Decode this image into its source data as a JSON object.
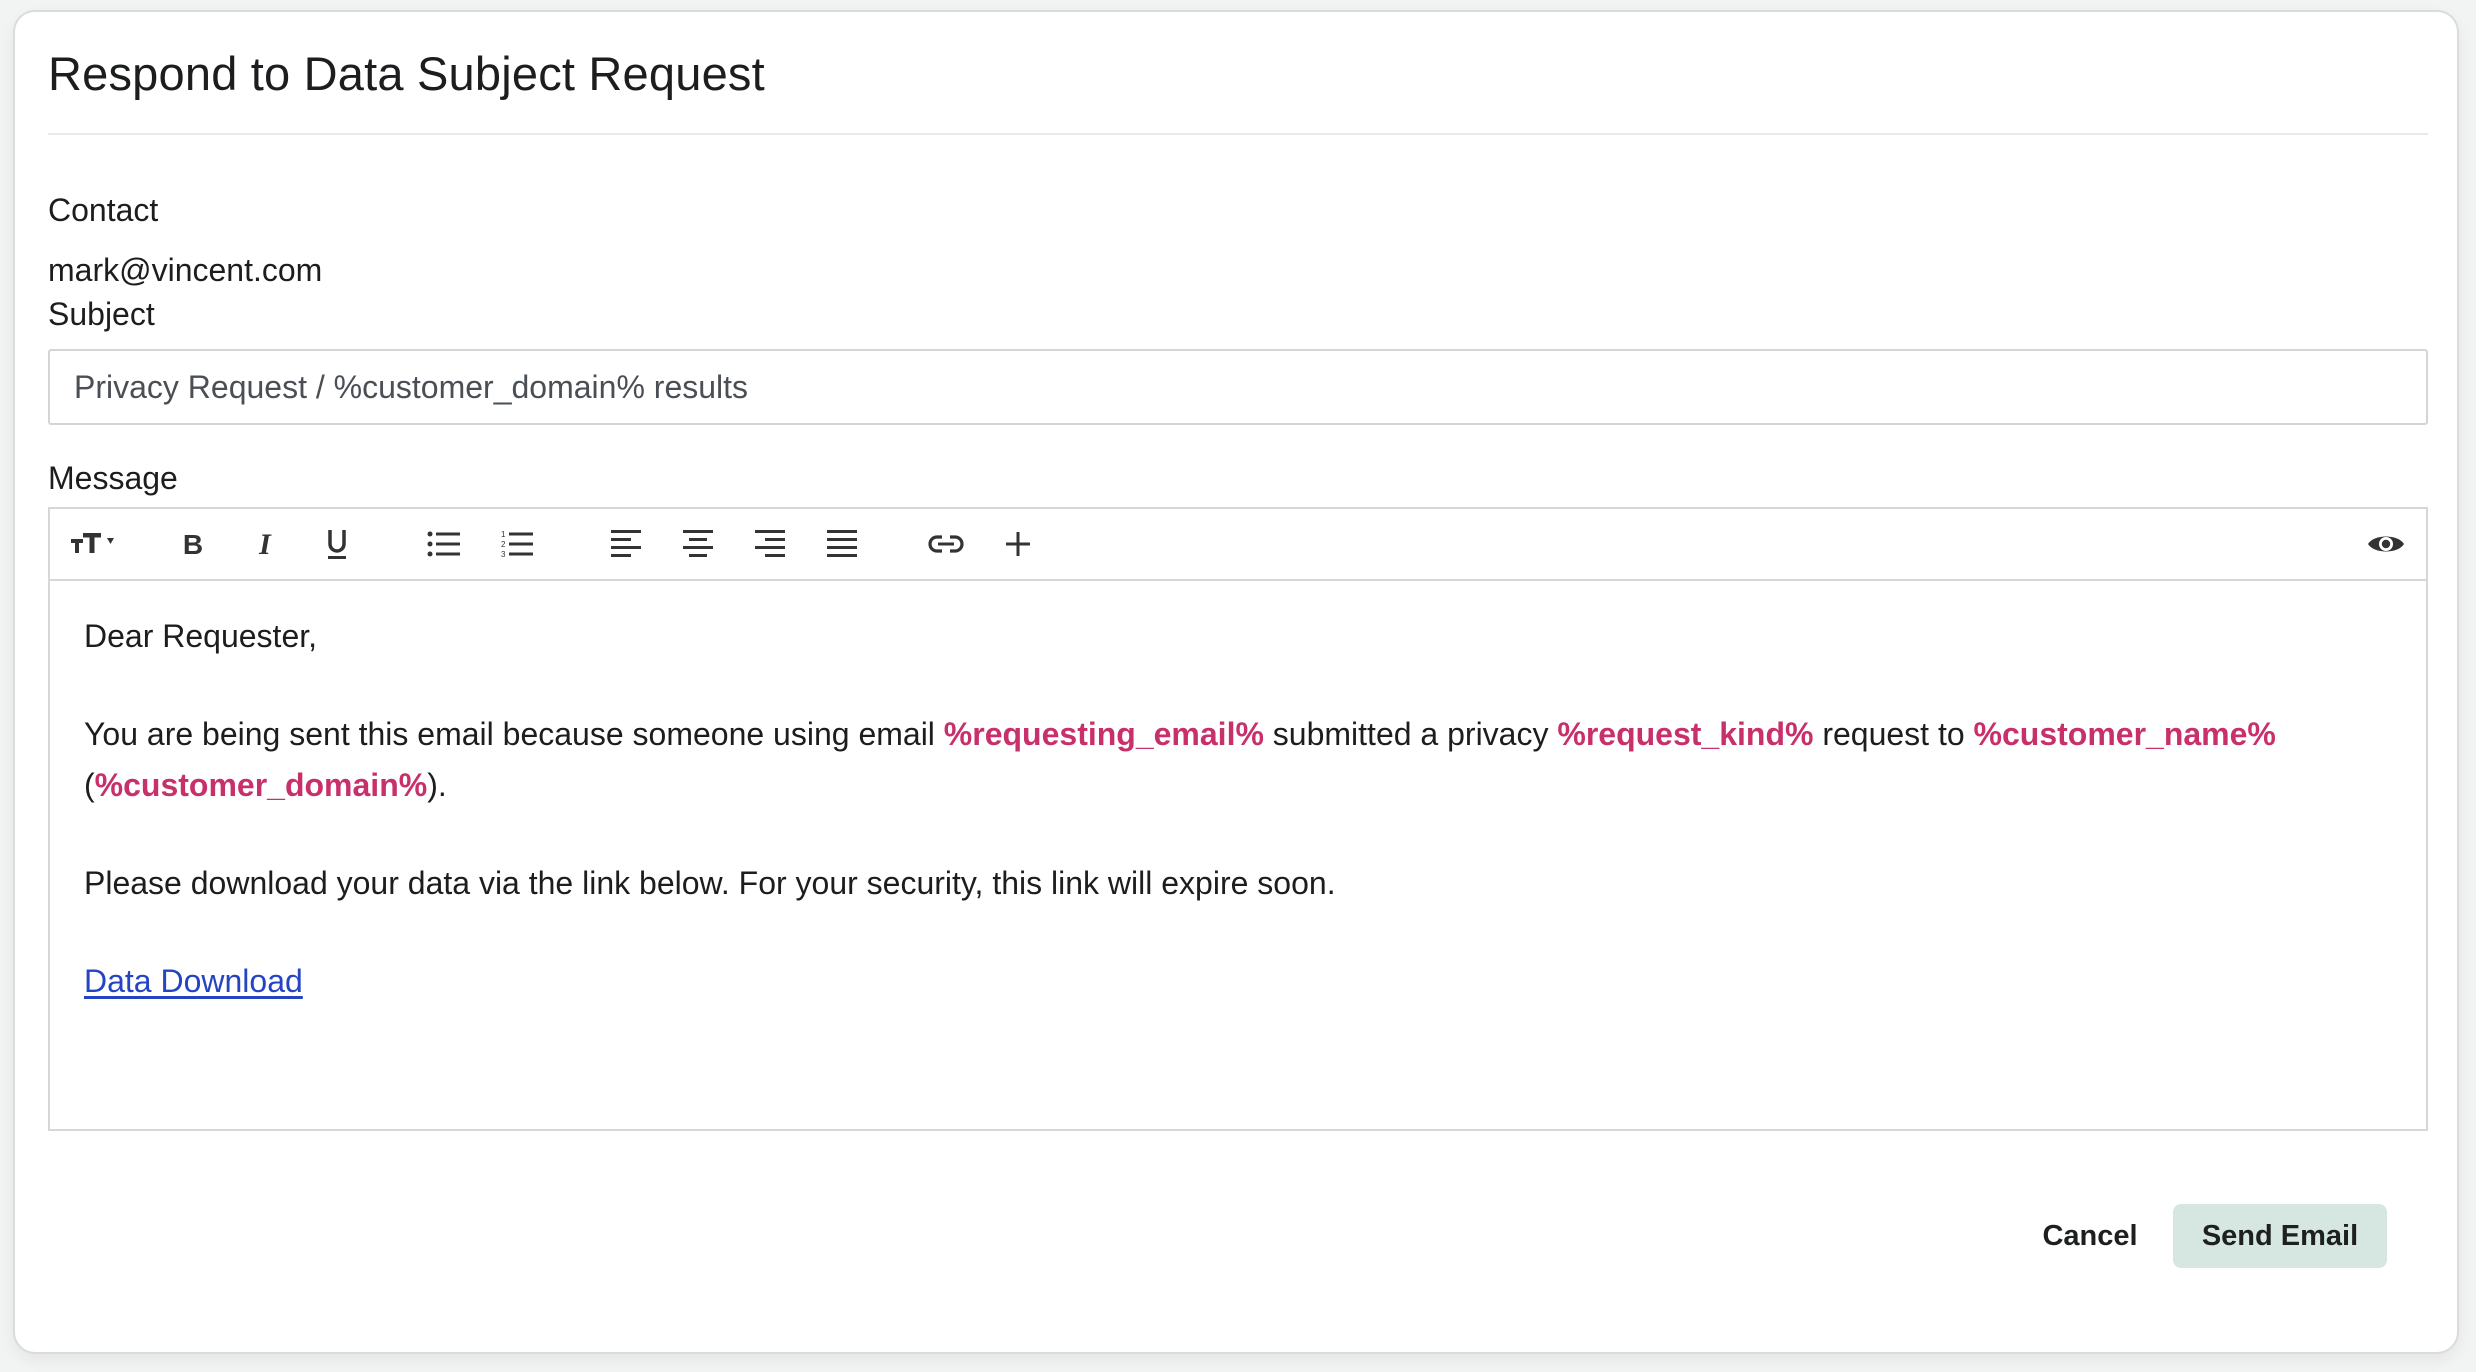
{
  "dialog": {
    "title": "Respond to Data Subject Request"
  },
  "contact": {
    "label": "Contact",
    "value": "mark@vincent.com"
  },
  "subject": {
    "label": "Subject",
    "value": "Privacy Request / %customer_domain% results"
  },
  "message": {
    "label": "Message",
    "toolbar": {
      "items": [
        {
          "name": "font-size",
          "icon": "font-size-icon"
        },
        {
          "name": "bold",
          "icon": "bold-icon"
        },
        {
          "name": "italic",
          "icon": "italic-icon"
        },
        {
          "name": "underline",
          "icon": "underline-icon"
        },
        {
          "name": "bulleted-list",
          "icon": "bulleted-list-icon"
        },
        {
          "name": "numbered-list",
          "icon": "numbered-list-icon"
        },
        {
          "name": "align-left",
          "icon": "align-left-icon"
        },
        {
          "name": "align-center",
          "icon": "align-center-icon"
        },
        {
          "name": "align-right",
          "icon": "align-right-icon"
        },
        {
          "name": "align-justify",
          "icon": "align-justify-icon"
        },
        {
          "name": "insert-link",
          "icon": "link-icon"
        },
        {
          "name": "insert-variable",
          "icon": "plus-icon"
        },
        {
          "name": "preview",
          "icon": "eye-icon"
        }
      ]
    },
    "body": {
      "greeting": "Dear Requester,",
      "para1": {
        "t1": "You are being sent this email because someone using email ",
        "v1": "%requesting_email%",
        "t2": " submitted a privacy ",
        "v2": "%request_kind%",
        "t3": " request to ",
        "v3": "%customer_name%",
        "t4": " (",
        "v4": "%customer_domain%",
        "t5": ")."
      },
      "para2": "Please download your data via the link below. For your security, this link will expire soon.",
      "link_text": "Data Download"
    },
    "variable_color": "#c8306b",
    "link_color": "#2444c4"
  },
  "actions": {
    "cancel_label": "Cancel",
    "send_label": "Send Email",
    "send_bg": "#d6e6e0"
  }
}
